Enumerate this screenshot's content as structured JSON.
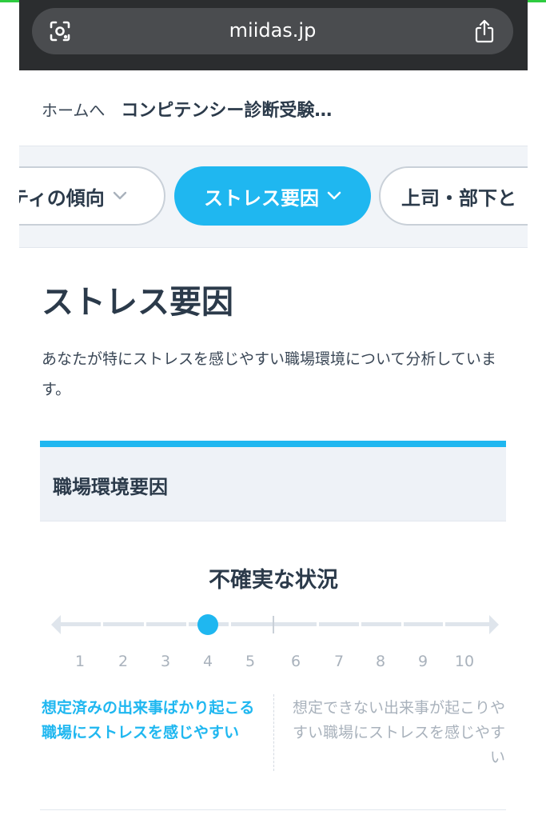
{
  "browser": {
    "url": "miidas.jp",
    "lens_icon": "camera-lens-icon",
    "share_icon": "share-icon"
  },
  "breadcrumb": {
    "home": "ホームへ",
    "current": "コンピテンシー診断受験…"
  },
  "tabs": [
    {
      "label": "ティの傾向",
      "active": false
    },
    {
      "label": "ストレス要因",
      "active": true
    },
    {
      "label": "上司・部下と",
      "active": false
    }
  ],
  "page": {
    "title": "ストレス要因",
    "description": "あなたが特にストレスを感じやすい職場環境について分析しています。"
  },
  "section": {
    "title": "職場環境要因",
    "factor": {
      "name": "不確実な状況",
      "scale": [
        "1",
        "2",
        "3",
        "4",
        "5",
        "6",
        "7",
        "8",
        "9",
        "10"
      ],
      "score": 4,
      "left_text": "想定済みの出来事ばかり起こる職場にストレスを感じやすい",
      "right_text": "想定できない出来事が起こりやすい職場にストレスを感じやすい"
    }
  },
  "colors": {
    "accent": "#1fb7f0",
    "text": "#2b3a4a",
    "muted": "#a9b2bc",
    "browser_bar": "#2b2d2f"
  }
}
